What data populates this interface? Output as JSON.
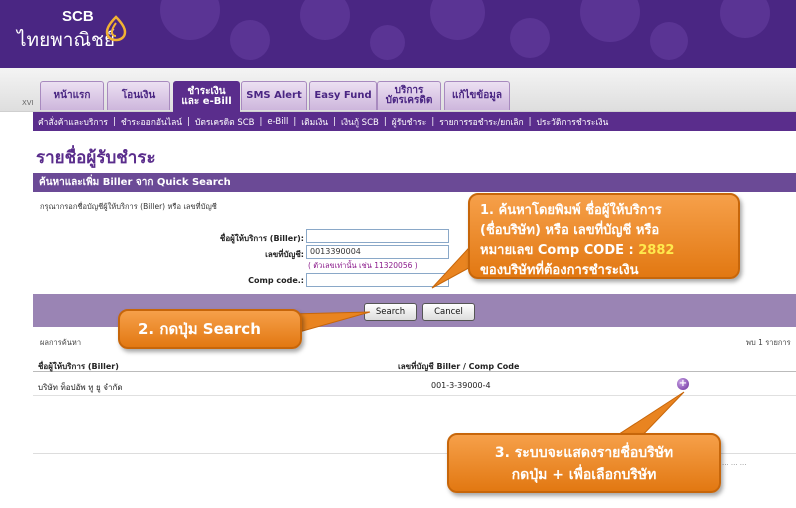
{
  "brand": {
    "name_top": "SCB",
    "name_bottom": "ไทยพาณิชย์"
  },
  "tabs": [
    {
      "label": "หน้าแรก"
    },
    {
      "label": "โอนเงิน"
    },
    {
      "label_line1": "ชำระเงิน",
      "label_line2": "และ e-Bill",
      "active": true
    },
    {
      "label": "SMS Alert"
    },
    {
      "label": "Easy Fund"
    },
    {
      "label_line1": "บริการ",
      "label_line2": "บัตรเครดิต"
    },
    {
      "label": "แก้ไขข้อมูล"
    }
  ],
  "tabbar_left_text": "XVI",
  "subnav": [
    "คำสั่งค้าและบริการ",
    "ชำระออกอันไลน์",
    "บัตรเครดิต SCB",
    "e-Bill",
    "เติมเงิน",
    "เงินกู้ SCB",
    "ผู้รับชำระ",
    "รายการรอชำระ/ยกเลิก",
    "ประวัติการชำระเงิน"
  ],
  "page_title": "รายชื่อผู้รับชำระ",
  "section_title": "ค้นหาและเพิ่ม Biller จาก Quick Search",
  "hint": "กรุณากรอกชื่อบัญชีผู้ให้บริการ (Biller) หรือ เลขที่บัญชี",
  "form": {
    "biller_label": "ชื่อผู้ให้บริการ (Biller):",
    "biller_value": "",
    "account_label": "เลขที่บัญชี:",
    "account_value": "0013390004",
    "account_note": "( ตัวเลขเท่านั้น เช่น 11320056 )",
    "comp_label": "Comp code.:",
    "comp_value": ""
  },
  "buttons": {
    "search": "Search",
    "cancel": "Cancel"
  },
  "results": {
    "label": "ผลการค้นหา",
    "count": "พบ 1 รายการ",
    "col_biller": "ชื่อผู้ให้บริการ (Biller)",
    "col_account": "เลขที่บัญชี Biller / Comp Code",
    "rows": [
      {
        "biller": "บริษัท ท็อปอัพ ทู ยู จำกัด",
        "account": "001-3-39000-4",
        "action": "+"
      }
    ]
  },
  "partial_text": "... ... ...",
  "callouts": {
    "c1_line1": "1. ค้นหาโดยพิมพ์ ชื่อผู้ให้บริการ",
    "c1_line2": "(ชื่อบริษัท) หรือ เลขที่บัญชี หรือ",
    "c1_line3a": "หมายเลข Comp CODE : ",
    "c1_code": "2882",
    "c1_line4": "ของบริษัทที่ต้องการชำระเงิน",
    "c2": "2. กดปุ่ม Search",
    "c3_line1": "3. ระบบจะแสดงรายชื่อบริษัท",
    "c3_line2": "กดปุ่ม + เพื่อเลือกบริษัท"
  },
  "colors": {
    "brand_purple": "#4a2683",
    "menu_purple": "#5a2d8c",
    "callout_orange": "#f08a24",
    "code_yellow": "#ffe94d"
  }
}
